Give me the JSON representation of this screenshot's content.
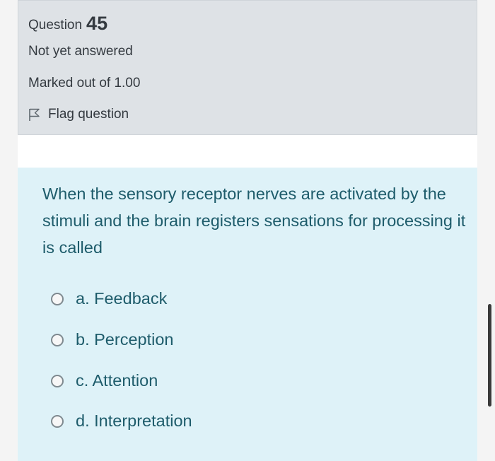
{
  "info": {
    "question_label": "Question",
    "question_number": "45",
    "state": "Not yet answered",
    "grade": "Marked out of 1.00",
    "flag_label": "Flag question"
  },
  "question": {
    "text": "When the sensory receptor nerves are activated by the stimuli and the brain registers sensations for processing it is called",
    "answers": [
      {
        "label": "a. Feedback",
        "selected": false
      },
      {
        "label": "b. Perception",
        "selected": false
      },
      {
        "label": "c. Attention",
        "selected": false
      },
      {
        "label": "d. Interpretation",
        "selected": false
      }
    ]
  },
  "colors": {
    "info_bg": "#dee2e6",
    "content_bg": "#def2f8",
    "question_text": "#1e5c6b",
    "info_text": "#343a40"
  },
  "icons": {
    "flag": "flag-icon",
    "radio": "radio-button"
  }
}
